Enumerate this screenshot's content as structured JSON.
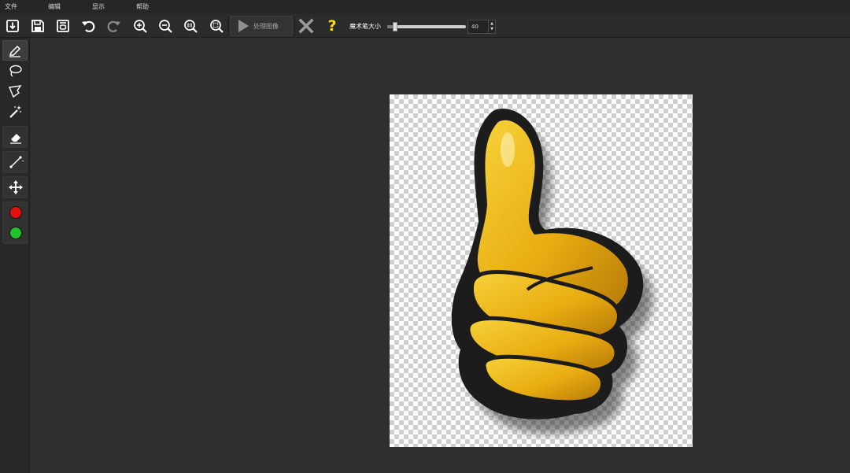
{
  "menu": {
    "items": [
      {
        "label": "文件"
      },
      {
        "label": "编辑"
      },
      {
        "label": "显示"
      },
      {
        "label": "帮助"
      }
    ]
  },
  "toolbar": {
    "icons": [
      "open-icon",
      "save-icon",
      "save-as-icon",
      "undo-icon",
      "redo-icon",
      "zoom-in-icon",
      "zoom-out-icon",
      "zoom-actual-icon",
      "zoom-fit-icon"
    ],
    "process_label": "处理图像",
    "brush_size_label": "魔术笔大小",
    "brush_size_value": "40",
    "brush_size_fraction": 0.1,
    "help_glyph": "?"
  },
  "tools": {
    "icons": [
      "marker-pen-icon",
      "lasso-icon",
      "polygon-lasso-icon",
      "magic-wand-icon",
      "eraser-icon",
      "line-icon",
      "move-icon"
    ],
    "colors": {
      "keep": "#e01010",
      "remove": "#22c22a"
    }
  },
  "canvas": {
    "image_subject": "thumbs-up-hand"
  }
}
